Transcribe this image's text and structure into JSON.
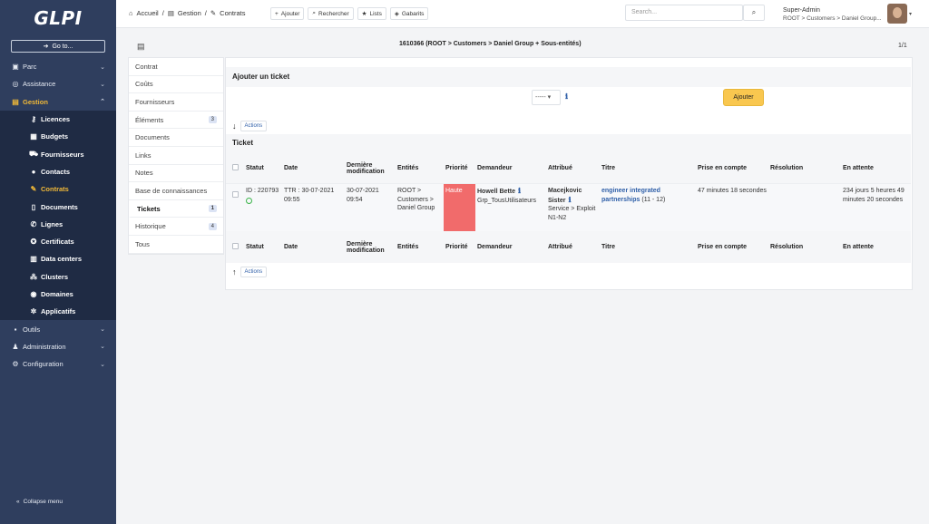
{
  "app": {
    "logo": "GLPI"
  },
  "sidebar": {
    "goto_label": "Go to...",
    "items": [
      {
        "label": "Parc",
        "icon": "box-icon"
      },
      {
        "label": "Assistance",
        "icon": "lifebuoy-icon"
      },
      {
        "label": "Gestion",
        "icon": "wallet-icon",
        "active": true
      }
    ],
    "sub_items": [
      {
        "label": "Licences",
        "icon": "key-icon"
      },
      {
        "label": "Budgets",
        "icon": "calculator-icon"
      },
      {
        "label": "Fournisseurs",
        "icon": "truck-icon"
      },
      {
        "label": "Contacts",
        "icon": "user-icon"
      },
      {
        "label": "Contrats",
        "icon": "contract-icon",
        "active": true
      },
      {
        "label": "Documents",
        "icon": "file-icon"
      },
      {
        "label": "Lignes",
        "icon": "phone-icon"
      },
      {
        "label": "Certificats",
        "icon": "certificate-icon"
      },
      {
        "label": "Data centers",
        "icon": "database-icon"
      },
      {
        "label": "Clusters",
        "icon": "cluster-icon"
      },
      {
        "label": "Domaines",
        "icon": "globe-icon"
      },
      {
        "label": "Applicatifs",
        "icon": "gears-icon"
      }
    ],
    "bottom_items": [
      {
        "label": "Outils",
        "icon": "briefcase-icon"
      },
      {
        "label": "Administration",
        "icon": "users-cog-icon"
      },
      {
        "label": "Configuration",
        "icon": "cogs-icon"
      }
    ],
    "collapse_label": "Collapse menu"
  },
  "header": {
    "breadcrumb": [
      "Accueil",
      "Gestion",
      "Contrats"
    ],
    "toolbar": {
      "add": "Ajouter",
      "search": "Rechercher",
      "lists": "Lists",
      "templates": "Gabarits"
    },
    "search_placeholder": "Search...",
    "user_name": "Super-Admin",
    "user_entity": "ROOT > Customers > Daniel Group..."
  },
  "page": {
    "title": "1610366 (ROOT > Customers > Daniel Group + Sous-entités)",
    "pager": "1/1"
  },
  "tabs": [
    {
      "label": "Contrat",
      "badge": ""
    },
    {
      "label": "Coûts",
      "badge": ""
    },
    {
      "label": "Fournisseurs",
      "badge": ""
    },
    {
      "label": "Éléments",
      "badge": "3"
    },
    {
      "label": "Documents",
      "badge": ""
    },
    {
      "label": "Links",
      "badge": ""
    },
    {
      "label": "Notes",
      "badge": ""
    },
    {
      "label": "Base de connaissances",
      "badge": ""
    },
    {
      "label": "Tickets",
      "badge": "1",
      "active": true
    },
    {
      "label": "Historique",
      "badge": "4"
    },
    {
      "label": "Tous",
      "badge": ""
    }
  ],
  "main": {
    "add_ticket_title": "Ajouter un ticket",
    "select_value": "-----",
    "add_button": "Ajouter",
    "actions_label": "Actions",
    "ticket_section_title": "Ticket",
    "columns": [
      "Statut",
      "Date",
      "Dernière modification",
      "Entités",
      "Priorité",
      "Demandeur",
      "Attribué",
      "Titre",
      "Prise en compte",
      "Résolution",
      "En attente"
    ],
    "row": {
      "status_id": "ID : 220793",
      "date": "TTR : 30-07-2021 09:55",
      "last_mod": "30-07-2021 09:54",
      "entity": "ROOT > Customers > Daniel Group",
      "priority": "Haute",
      "requester_name": "Howell Bette",
      "requester_group": "Grp_TousUtilisateurs",
      "assignee_name": "Macejkovic Sister",
      "assignee_group": "Service > Exploit N1-N2",
      "title": "engineer integrated partnerships",
      "title_suffix": "(11 - 12)",
      "take_into_account": "47 minutes 18 secondes",
      "resolution": "",
      "pending": "234 jours 5 heures 49 minutes 20 secondes"
    }
  },
  "colors": {
    "sidebar_bg": "#2f3e5e",
    "accent": "#f1b938",
    "priority_high": "#f16b6b",
    "add_button": "#f9c74f",
    "link": "#2f5fa8"
  }
}
